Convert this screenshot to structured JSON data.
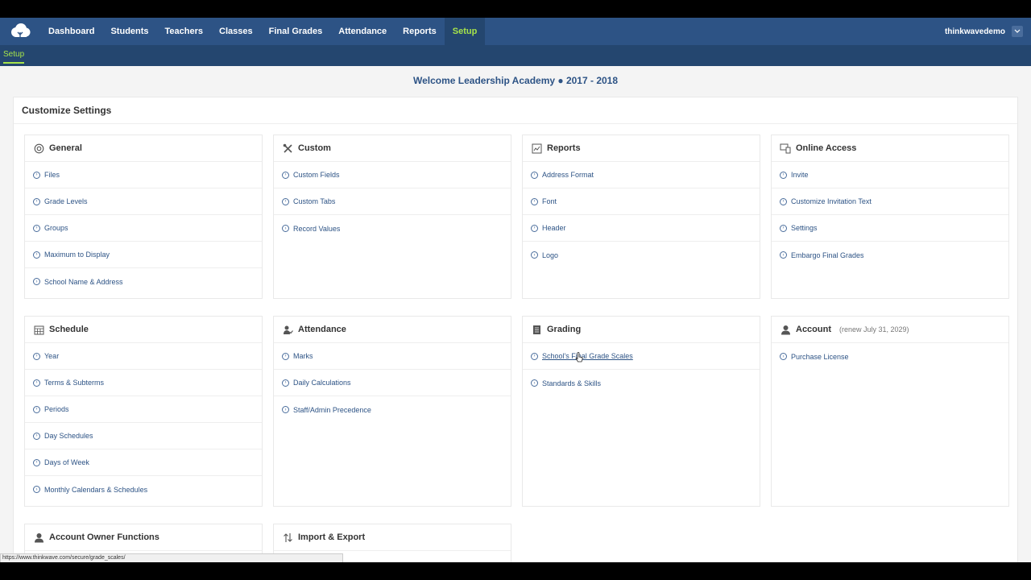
{
  "nav": {
    "items": [
      "Dashboard",
      "Students",
      "Teachers",
      "Classes",
      "Final Grades",
      "Attendance",
      "Reports",
      "Setup"
    ],
    "active": "Setup",
    "username": "thinkwavedemo"
  },
  "subnav": {
    "label": "Setup"
  },
  "welcome": "Welcome Leadership Academy  ● 2017 - 2018",
  "panel_title": "Customize Settings",
  "cards": {
    "general": {
      "title": "General",
      "items": [
        "Files",
        "Grade Levels",
        "Groups",
        "Maximum to Display",
        "School Name & Address"
      ]
    },
    "custom": {
      "title": "Custom",
      "items": [
        "Custom Fields",
        "Custom Tabs",
        "Record Values"
      ]
    },
    "reports": {
      "title": "Reports",
      "items": [
        "Address Format",
        "Font",
        "Header",
        "Logo"
      ]
    },
    "online": {
      "title": "Online Access",
      "items": [
        "Invite",
        "Customize Invitation Text",
        "Settings",
        "Embargo Final Grades"
      ]
    },
    "schedule": {
      "title": "Schedule",
      "items": [
        "Year",
        "Terms & Subterms",
        "Periods",
        "Day Schedules",
        "Days of Week",
        "Monthly Calendars & Schedules"
      ]
    },
    "attendance": {
      "title": "Attendance",
      "items": [
        "Marks",
        "Daily Calculations",
        "Staff/Admin Precedence"
      ]
    },
    "grading": {
      "title": "Grading",
      "items": [
        "School's Final Grade Scales",
        "Standards & Skills"
      ]
    },
    "account": {
      "title": "Account",
      "note": "(renew July 31, 2029)",
      "items": [
        "Purchase License"
      ]
    },
    "owner": {
      "title": "Account Owner Functions"
    },
    "import": {
      "title": "Import & Export"
    }
  },
  "status_url": "https://www.thinkwave.com/secure/grade_scales/",
  "colors": {
    "nav_bg": "#2d5385",
    "active_accent": "#a6e34a",
    "link": "#2d5385"
  }
}
